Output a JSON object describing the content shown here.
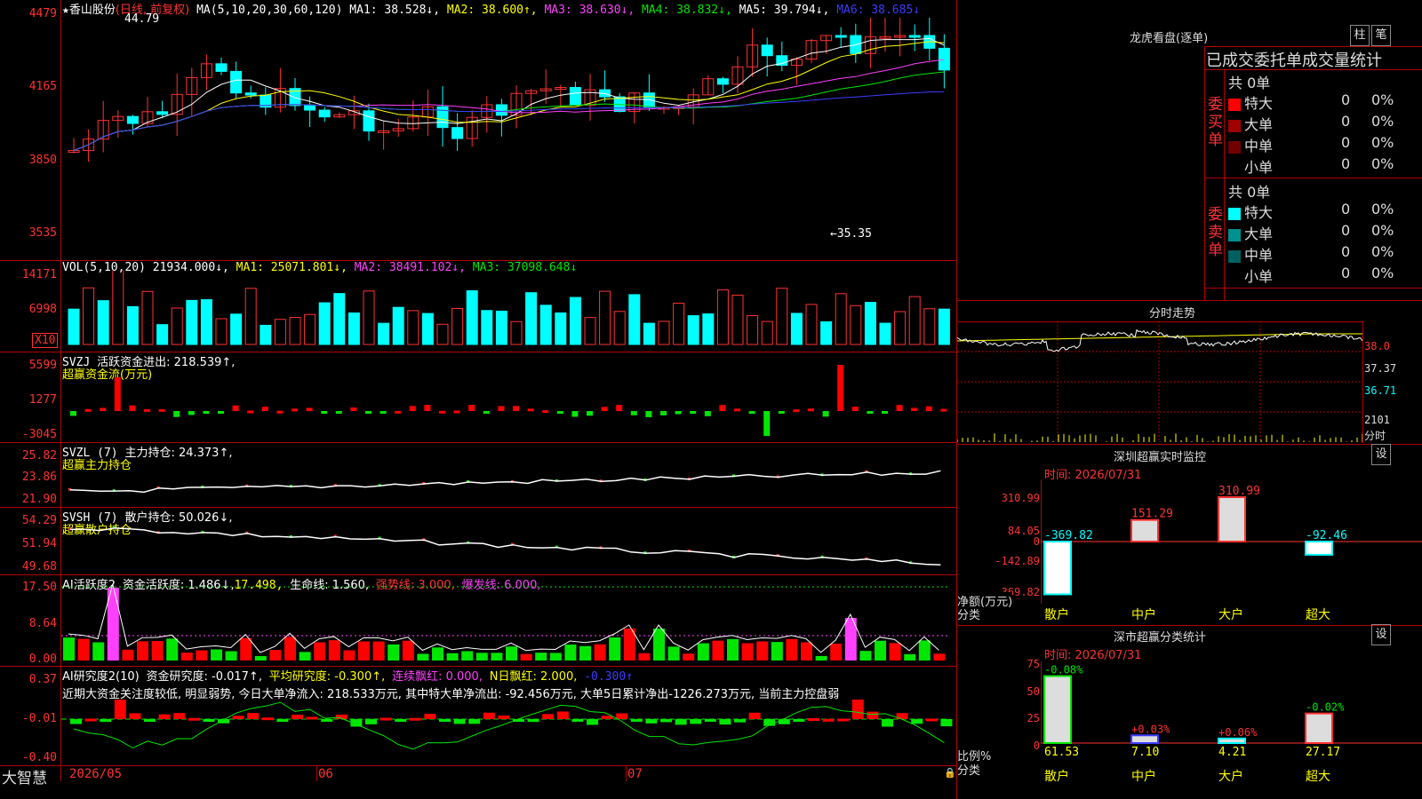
{
  "main": {
    "title_star": "★",
    "stock_name": "香山股份",
    "period": "(日线, 前复权)",
    "ma_label": "MA(5,10,20,30,60,120)",
    "ma1": "MA1: 38.528↓,",
    "ma2": "MA2: 38.600↑,",
    "ma3": "MA3: 38.630↓,",
    "ma4": "MA4: 38.832↓,",
    "ma5": "MA5: 39.794↓,",
    "ma6": "MA6: 38.685↓",
    "high_marker": "44.79",
    "low_marker": "←35.35",
    "axis": [
      "4479",
      "4165",
      "3850",
      "3535"
    ]
  },
  "vol": {
    "label": "VOL(5,10,20)",
    "value": "21934.000↓,",
    "ma1": "MA1: 25071.801↓,",
    "ma2": "MA2: 38491.102↓,",
    "ma3": "MA3: 37098.648↓",
    "axis": [
      "14171",
      "6998"
    ],
    "unit": "X10"
  },
  "svzj": {
    "label": "SVZJ",
    "text": "活跃资金进出: 218.539↑,",
    "sub": "超赢资金流(万元)",
    "axis": [
      "5599",
      "1277",
      "-3045"
    ]
  },
  "svzl": {
    "label": "SVZL (7)",
    "text": "主力持仓: 24.373↑,",
    "sub": "超赢主力持仓",
    "axis": [
      "25.82",
      "23.86",
      "21.90"
    ]
  },
  "svsh": {
    "label": "SVSH (7)",
    "text": "散户持仓: 50.026↓,",
    "sub": "超赢散户持仓",
    "axis": [
      "54.29",
      "51.94",
      "49.68"
    ]
  },
  "ai1": {
    "label": "AI活跃度2",
    "t1": "资金活跃度: 1.486↓,",
    "t2": "17.498,",
    "t3": "生命线: 1.560,",
    "t4": "强势线: 3.000,",
    "t5": "爆发线: 6.000,",
    "axis": [
      "17.50",
      "8.64",
      "0.00"
    ]
  },
  "ai2": {
    "label": "AI研究度2(10)",
    "t1": "资金研究度: -0.017↑,",
    "t2": "平均研究度: -0.300↑,",
    "t3": "连续飘红: 0.000,",
    "t4": "N日飘红: 2.000,",
    "t5": "-0.300↑",
    "note": "近期大资金关注度较低, 明显弱势, 今日大单净流入: 218.533万元, 其中特大单净流出: -92.456万元, 大单5日累计净出-1226.273万元, 当前主力控盘弱",
    "axis": [
      "0.37",
      "-0.01",
      "-0.40"
    ]
  },
  "bottom": {
    "brand": "大智慧",
    "dates": [
      "2026/05",
      "06",
      "07"
    ]
  },
  "right": {
    "lhb_title": "龙虎看盘(逐单)",
    "btn_zhu": "柱",
    "btn_bi": "笔",
    "stat_title": "已成交委托单成交量统计",
    "buy": {
      "side": "委买单",
      "total": "共 0单",
      "rows": [
        {
          "name": "特大",
          "n": "0",
          "p": "0%",
          "color": "#ff0000"
        },
        {
          "name": "大单",
          "n": "0",
          "p": "0%",
          "color": "#a00000"
        },
        {
          "name": "中单",
          "n": "0",
          "p": "0%",
          "color": "#700000"
        },
        {
          "name": "小单",
          "n": "0",
          "p": "0%",
          "color": "#000000"
        }
      ]
    },
    "sell": {
      "side": "委卖单",
      "total": "共 0单",
      "rows": [
        {
          "name": "特大",
          "n": "0",
          "p": "0%",
          "color": "#00ffff"
        },
        {
          "name": "大单",
          "n": "0",
          "p": "0%",
          "color": "#009090"
        },
        {
          "name": "中单",
          "n": "0",
          "p": "0%",
          "color": "#006060"
        },
        {
          "name": "小单",
          "n": "0",
          "p": "0%",
          "color": "#000000"
        }
      ]
    },
    "fs_title": "分时走势",
    "fs_axis": [
      "38.0",
      "37.37",
      "36.71",
      "2101",
      "分时"
    ],
    "mon_title": "深圳超赢实时监控",
    "mon_btn": "设",
    "mon_time": "时间: 2026/07/31",
    "mon_axis": [
      "310.99",
      "84.05",
      "0",
      "-142.89",
      "-369.82"
    ],
    "mon_ylabel1": "净额(万元)",
    "mon_ylabel2": "分类",
    "mon_cats": [
      "散户",
      "中户",
      "大户",
      "超大"
    ],
    "mon_vals": [
      "-369.82",
      "151.29",
      "310.99",
      "-92.46"
    ],
    "cls_title": "深市超赢分类统计",
    "cls_btn": "设",
    "cls_time": "时间: 2026/07/31",
    "cls_axis": [
      "75",
      "50",
      "25",
      "0"
    ],
    "cls_ylabel1": "比例%",
    "cls_ylabel2": "分类",
    "cls_cats": [
      "散户",
      "中户",
      "大户",
      "超大"
    ],
    "cls_pct": [
      "61.53",
      "7.10",
      "4.21",
      "27.17"
    ],
    "cls_chg": [
      "-0.08%",
      "+0.03%",
      "+0.06%",
      "-0.02%"
    ]
  }
}
